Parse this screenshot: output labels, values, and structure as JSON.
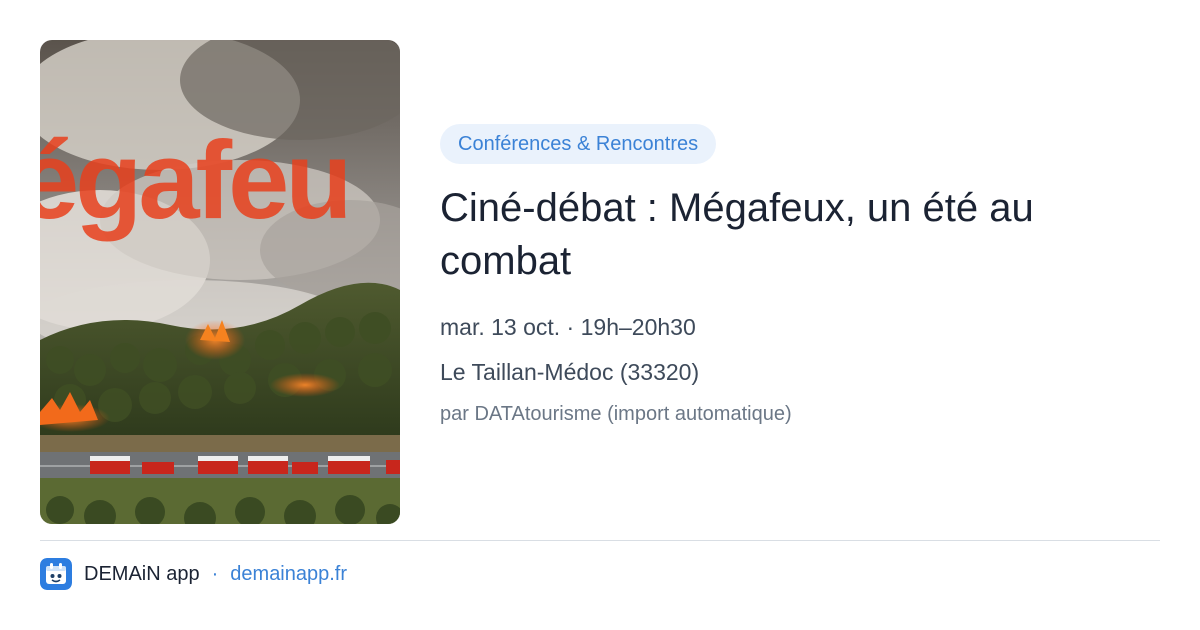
{
  "event": {
    "category": "Conférences & Rencontres",
    "title": "Ciné-débat : Mégafeux, un été au combat",
    "datetime": "mar. 13 oct. · 19h–20h30",
    "location": "Le Taillan-Médoc (33320)",
    "source": "par DATAtourisme (import automatique)"
  },
  "poster": {
    "overlay_text": "égafeu"
  },
  "footer": {
    "app_name": "DEMAiN app",
    "separator": "·",
    "domain": "demainapp.fr",
    "app_icon": "demain-app-icon"
  },
  "colors": {
    "accent": "#3b82d6",
    "badge_bg": "#eaf2fc",
    "title": "#1b2333",
    "fire": "#e8401c"
  }
}
